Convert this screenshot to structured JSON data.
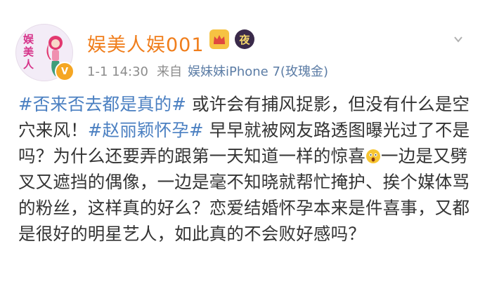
{
  "post": {
    "username": "娱美人娱001",
    "avatar_text": [
      "娱",
      "美",
      "人"
    ],
    "verified_badge": "V",
    "night_badge": "夜",
    "meta": {
      "time": "1-1 14:30",
      "from_label": "来自",
      "source": "娱妹妹iPhone 7(玫瑰金)"
    },
    "content": {
      "tag1": "#否来否去都是真的#",
      "seg1": " 或许会有捕风捉影，但没有什么是空穴来风！",
      "tag2": "#赵丽颖怀孕#",
      "seg2": " 早早就被网友路透图曝光过了不是吗？为什么还要弄的跟第一天知道一样的惊喜",
      "seg3": "一边是又劈叉又遮挡的偶像，一边是毫不知晓就帮忙掩护、挨个媒体骂的粉丝，这样真的好么？恋爱结婚怀孕本来是件喜事，又都是很好的明星艺人，如此真的不会败好感吗？"
    },
    "icons": {
      "crown": "crown-icon",
      "dropdown": "chevron-down-icon",
      "emoji": "shocked-face-emoji"
    },
    "colors": {
      "username": "#f07e1c",
      "tag": "#4a7fc1",
      "source": "#5b7ca5",
      "meta": "#8c8c8c"
    }
  }
}
